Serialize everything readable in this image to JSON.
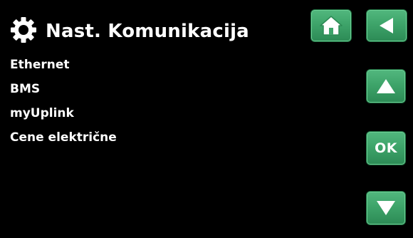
{
  "header": {
    "icon": "gear-icon",
    "title": "Nast. Komunikacija"
  },
  "menu": {
    "items": [
      {
        "label": "Ethernet"
      },
      {
        "label": "BMS"
      },
      {
        "label": "myUplink"
      },
      {
        "label": "Cene električne"
      }
    ]
  },
  "buttons": {
    "home": {
      "icon": "home-icon"
    },
    "back": {
      "icon": "back-arrow-icon"
    },
    "up": {
      "icon": "arrow-up-icon"
    },
    "ok": {
      "label": "OK"
    },
    "down": {
      "icon": "arrow-down-icon"
    }
  },
  "colors": {
    "background": "#000000",
    "text": "#ffffff",
    "button": "#3ea46a"
  }
}
